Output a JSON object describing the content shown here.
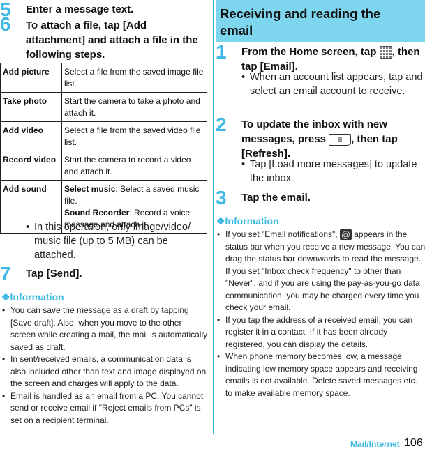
{
  "left": {
    "step5": {
      "num": "5",
      "text": "Enter a message text."
    },
    "step6": {
      "num": "6",
      "text": "To attach a file, tap [Add attachment] and attach a file in the following steps."
    },
    "table": [
      {
        "key": "Add picture",
        "value": "Select a file from the saved image file list."
      },
      {
        "key": "Take photo",
        "value": "Start the camera to take a photo and attach it."
      },
      {
        "key": "Add video",
        "value": "Select a file from the saved video file list."
      },
      {
        "key": "Record video",
        "value": "Start the camera to record a video and attach it."
      },
      {
        "key": "Add sound",
        "sub": [
          {
            "bold": "Select music",
            "text": ": Select a saved music file."
          },
          {
            "bold": "Sound Recorder",
            "text": ": Record a voice message and attach it."
          }
        ]
      }
    ],
    "step6_note": "In this operation, only image/video/ music file (up to 5 MB) can be attached.",
    "step7": {
      "num": "7",
      "text": "Tap [Send]."
    },
    "info": {
      "heading": "❖Information",
      "items": [
        "You can save the message as a draft by tapping [Save draft]. Also, when you move to the other screen while creating a mail, the mail is automatically saved as draft.",
        "In sent/received emails, a communication data is also included other than text and image displayed on the screen and charges will apply to the data.",
        "Email is handled as an email from a PC. You cannot send or receive email if \"Reject emails from PCs\" is set on a recipient terminal."
      ]
    }
  },
  "right": {
    "section_title": "Receiving and reading the email",
    "step1": {
      "num": "1",
      "text_a": "From the Home screen, tap ",
      "icon": "apps-grid-icon",
      "text_b": ", then tap [Email].",
      "note": "When an account list appears, tap and select an email account to receive."
    },
    "step2": {
      "num": "2",
      "text_a": "To update the inbox with new messages, press ",
      "icon": "menu-key-icon",
      "icon_glyph": "≡",
      "text_b": ", then tap [Refresh].",
      "note": "Tap [Load more messages] to update the inbox."
    },
    "step3": {
      "num": "3",
      "text": "Tap the email."
    },
    "info": {
      "heading": "❖Information",
      "item1_a": "If you set \"Email notifications\", ",
      "item1_icon_glyph": "@",
      "item1_b": " appears in the status bar when you receive a new message. You can drag the status bar downwards to read the message. If you set \"Inbox check frequency\" to other than \"Never\", and if you are using the pay-as-you-go data communication, you may be charged every time you check your email.",
      "items": [
        "If you tap the address of a received email, you can register it in a contact. If it has been already registered, you can display the details.",
        "When phone memory becomes low, a message indicating low memory space appears and receiving emails is not available. Delete saved messages etc. to make available memory space."
      ]
    }
  },
  "footer": {
    "section": "Mail/Internet",
    "page": "106"
  },
  "colors": {
    "accent": "#3cb8e2",
    "section_bg": "#7dd6ee"
  }
}
